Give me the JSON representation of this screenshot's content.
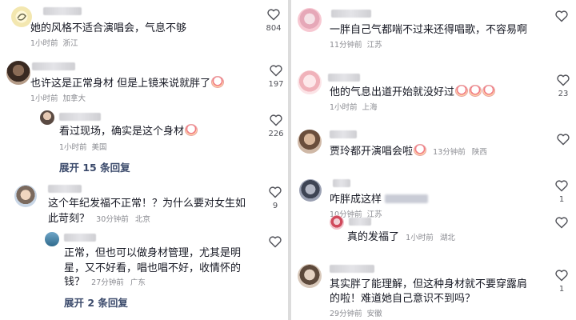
{
  "left": {
    "comments": [
      {
        "text": "她的风格不适合演唱会，气息不够",
        "time": "1小时前",
        "location": "浙江",
        "likes": "804"
      },
      {
        "text": "也许这是正常身材 但是上镜来说就胖了",
        "time": "1小时前",
        "location": "加拿大",
        "likes": "197",
        "reply": {
          "text": "看过现场，确实是这个身材",
          "time": "1小时前",
          "location": "美国",
          "likes": "226"
        },
        "expand": "展开 15 条回复"
      },
      {
        "text_line1": "这个年纪发福不正常！？为什么要对女生如",
        "text_line2": "此苛刻？",
        "time": "30分钟前",
        "location": "北京",
        "likes": "9",
        "reply": {
          "text_line1": "正常，但也可以做身材管理，尤其是明",
          "text_line2": "星，又不好看，唱也唱不好，收情怀的",
          "text_line3": "钱？",
          "time": "27分钟前",
          "location": "广东"
        },
        "expand": "展开 2 条回复"
      }
    ]
  },
  "right": {
    "comments": [
      {
        "text": "一胖自己气都喘不过来还得唱歌，不容易啊",
        "time": "11分钟前",
        "location": "江苏"
      },
      {
        "text": "他的气息出道开始就没好过",
        "time": "1小时前",
        "location": "上海",
        "likes": "23"
      },
      {
        "text": "贾玲都开演唱会啦",
        "time": "13分钟前",
        "location": "陕西"
      },
      {
        "text": "咋胖成这样",
        "time": "10分钟前",
        "location": "江苏",
        "likes": "1",
        "reply": {
          "text": "真的发福了",
          "time": "1小时前",
          "location": "湖北"
        }
      },
      {
        "text_line1": "其实胖了能理解，但这种身材就不要穿露肩",
        "text_line2": "的啦！难道她自己意识不到吗？",
        "time": "29分钟前",
        "location": "安徽",
        "likes": "1"
      }
    ]
  }
}
